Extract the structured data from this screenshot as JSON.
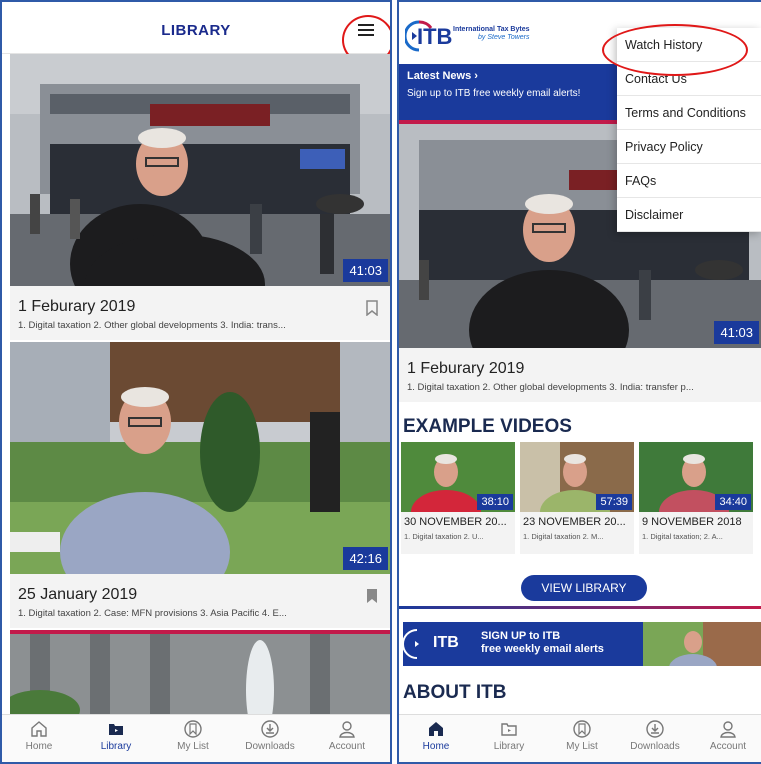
{
  "library": {
    "title": "LIBRARY",
    "videos": [
      {
        "date": "1 Feburary 2019",
        "desc": "1. Digital taxation 2. Other global developments 3. India: trans...",
        "duration": "41:03",
        "bookmarked": false
      },
      {
        "date": "25 January 2019",
        "desc": "1. Digital taxation 2. Case: MFN provisions 3. Asia Pacific 4. E...",
        "duration": "42:16",
        "bookmarked": true
      }
    ]
  },
  "tabs": [
    {
      "label": "Home",
      "icon": "home-icon"
    },
    {
      "label": "Library",
      "icon": "library-icon"
    },
    {
      "label": "My List",
      "icon": "my-list-icon"
    },
    {
      "label": "Downloads",
      "icon": "downloads-icon"
    },
    {
      "label": "Account",
      "icon": "account-icon"
    }
  ],
  "home": {
    "logo": {
      "mark": "ITB",
      "name": "International Tax Bytes",
      "byline": "by Steve Towers"
    },
    "latest_news": {
      "title": "Latest News ›",
      "subtitle": "Sign up to ITB free weekly email alerts!"
    },
    "menu": [
      "Watch History",
      "Contact Us",
      "Terms and Conditions",
      "Privacy Policy",
      "FAQs",
      "Disclaimer"
    ],
    "featured": {
      "date": "1 Feburary 2019",
      "desc": "1. Digital taxation 2. Other global developments 3. India: transfer p...",
      "duration": "41:03"
    },
    "example_title": "EXAMPLE VIDEOS",
    "examples": [
      {
        "date": "30 NOVEMBER 20...",
        "desc": "1. Digital taxation 2. U...",
        "duration": "38:10"
      },
      {
        "date": "23 NOVEMBER 20...",
        "desc": "1. Digital taxation 2. M...",
        "duration": "57:39"
      },
      {
        "date": "9 NOVEMBER 2018",
        "desc": "1. Digital taxation; 2. A...",
        "duration": "34:40"
      }
    ],
    "view_library": "VIEW LIBRARY",
    "banner": {
      "line1": "SIGN UP to ITB",
      "line2": "free weekly email alerts"
    },
    "about_title": "ABOUT ITB"
  },
  "colors": {
    "brand_blue": "#1a3a9c",
    "annotation_red": "#e01818",
    "active_tab": "#1a3a9c"
  }
}
